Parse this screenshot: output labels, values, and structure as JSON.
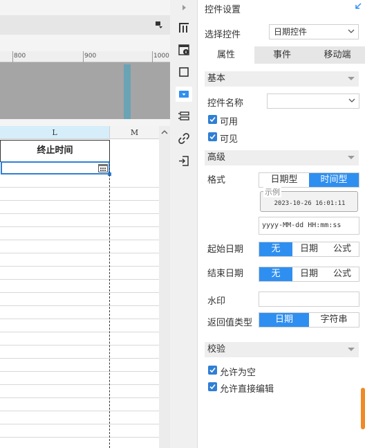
{
  "toolbar": {
    "dropdown_icon": "paint-dropdown-icon"
  },
  "ruler": {
    "labels": [
      "800",
      "900",
      "1000"
    ]
  },
  "sheet": {
    "columns": [
      "L",
      "M"
    ],
    "header_cell": "终止时间",
    "scroll_icon": "chevron-up-icon"
  },
  "iconbar": {
    "icons": [
      "expand-arrow-icon",
      "cell-layout-icon",
      "cell-info-icon",
      "frame-icon",
      "widget-icon",
      "condition-icon",
      "hyperlink-icon",
      "import-icon"
    ]
  },
  "panel": {
    "title": "控件设置",
    "select_label": "选择控件",
    "select_value": "日期控件",
    "tabs": [
      "属性",
      "事件",
      "移动端"
    ],
    "active_tab": "属性",
    "basic": {
      "section": "基本",
      "name_label": "控件名称",
      "name_value": "",
      "enabled_label": "可用",
      "visible_label": "可见"
    },
    "advanced": {
      "section": "高级",
      "format_label": "格式",
      "format_options": [
        "日期型",
        "时间型"
      ],
      "format_active": "时间型",
      "example_legend": "示例",
      "example_value": "2023-10-26 16:01:11",
      "format_pattern": "yyyy-MM-dd HH:mm:ss",
      "start_label": "起始日期",
      "start_options": [
        "无",
        "日期",
        "公式"
      ],
      "start_active": "无",
      "end_label": "结束日期",
      "end_options": [
        "无",
        "日期",
        "公式"
      ],
      "end_active": "无",
      "watermark_label": "水印",
      "watermark_value": "",
      "return_label": "返回值类型",
      "return_options": [
        "日期",
        "字符串"
      ],
      "return_active": "日期"
    },
    "validation": {
      "section": "校验",
      "allow_empty": "允许为空",
      "allow_edit": "允许直接编辑"
    }
  },
  "colors": {
    "accent": "#2f8ff0",
    "selection": "#2f7fd4",
    "scroll_accent": "#f08a24"
  }
}
